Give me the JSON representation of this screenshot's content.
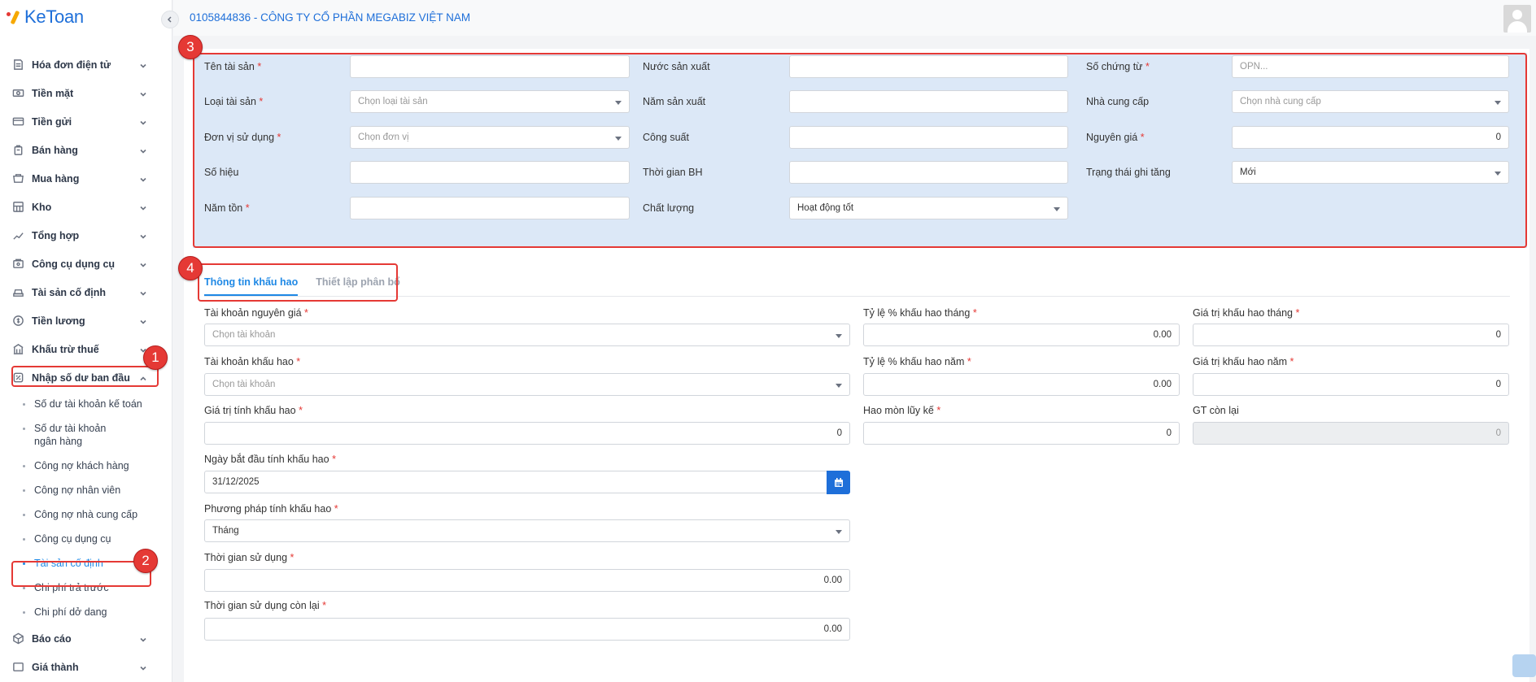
{
  "app": {
    "logo_text": "KeToan"
  },
  "header": {
    "company": "0105844836 - CÔNG TY CỔ PHẦN MEGABIZ VIỆT NAM"
  },
  "sidebar": {
    "items": [
      {
        "label": "Hóa đơn điện tử",
        "icon": "invoice-icon"
      },
      {
        "label": "Tiền mặt",
        "icon": "cash-icon"
      },
      {
        "label": "Tiền gửi",
        "icon": "bank-deposit-icon"
      },
      {
        "label": "Bán hàng",
        "icon": "sales-icon"
      },
      {
        "label": "Mua hàng",
        "icon": "purchase-icon"
      },
      {
        "label": "Kho",
        "icon": "warehouse-icon"
      },
      {
        "label": "Tổng hợp",
        "icon": "summary-icon"
      },
      {
        "label": "Công cụ dụng cụ",
        "icon": "tools-icon"
      },
      {
        "label": "Tài sản cố định",
        "icon": "fixed-asset-icon"
      },
      {
        "label": "Tiền lương",
        "icon": "salary-icon"
      },
      {
        "label": "Khấu trừ thuế",
        "icon": "tax-icon"
      },
      {
        "label": "Nhập số dư ban đầu",
        "icon": "opening-balance-icon"
      }
    ],
    "submenu": [
      "Số dư tài khoản kế toán",
      "Số dư tài khoản ngân hàng",
      "Công nợ khách hàng",
      "Công nợ nhân viên",
      "Công nợ nhà cung cấp",
      "Công cụ dụng cụ",
      "Tài sản cố định",
      "Chi phí trả trước",
      "Chi phí dở dang"
    ],
    "after": [
      {
        "label": "Báo cáo",
        "icon": "report-icon"
      },
      {
        "label": "Giá thành",
        "icon": "cost-icon"
      }
    ]
  },
  "form": {
    "ten_tai_san": {
      "label": "Tên tài sản",
      "value": ""
    },
    "nuoc_san_xuat": {
      "label": "Nước sản xuất",
      "value": ""
    },
    "so_chung_tu": {
      "label": "Số chứng từ",
      "placeholder": "OPN..."
    },
    "loai_tai_san": {
      "label": "Loại tài sản",
      "placeholder": "Chọn loại tài sản"
    },
    "nam_san_xuat": {
      "label": "Năm sản xuất",
      "value": ""
    },
    "nha_cung_cap": {
      "label": "Nhà cung cấp",
      "placeholder": "Chọn nhà cung cấp"
    },
    "don_vi_su_dung": {
      "label": "Đơn vị sử dụng",
      "placeholder": "Chọn đơn vị"
    },
    "cong_suat": {
      "label": "Công suất",
      "value": ""
    },
    "nguyen_gia": {
      "label": "Nguyên giá",
      "value": "0"
    },
    "so_hieu": {
      "label": "Số hiệu",
      "value": ""
    },
    "thoi_gian_bh": {
      "label": "Thời gian BH",
      "value": ""
    },
    "trang_thai_ghi_tang": {
      "label": "Trạng thái ghi tăng",
      "value": "Mới"
    },
    "nam_ton": {
      "label": "Năm tồn",
      "value": ""
    },
    "chat_luong": {
      "label": "Chất lượng",
      "value": "Hoạt động tốt"
    }
  },
  "tabs": [
    "Thông tin khấu hao",
    "Thiết lập phân bổ"
  ],
  "depreciation": {
    "tk_nguyen_gia": {
      "label": "Tài khoản nguyên giá",
      "placeholder": "Chọn tài khoản"
    },
    "ty_le_thang": {
      "label": "Tỷ lệ % khấu hao tháng",
      "value": "0.00"
    },
    "gia_tri_thang": {
      "label": "Giá trị khấu hao tháng",
      "value": "0"
    },
    "tk_khau_hao": {
      "label": "Tài khoản khấu hao",
      "placeholder": "Chọn tài khoản"
    },
    "ty_le_nam": {
      "label": "Tỷ lệ % khấu hao năm",
      "value": "0.00"
    },
    "gia_tri_nam": {
      "label": "Giá trị khấu hao năm",
      "value": "0"
    },
    "gia_tri_tinh": {
      "label": "Giá trị tính khấu hao",
      "value": "0"
    },
    "hao_mon": {
      "label": "Hao mòn lũy kế",
      "value": "0"
    },
    "gt_con_lai": {
      "label": "GT còn lại",
      "value": "0"
    },
    "ngay_bat_dau": {
      "label": "Ngày bắt đầu tính khấu hao",
      "value": "31/12/2025"
    },
    "phuong_phap": {
      "label": "Phương pháp tính khấu hao",
      "value": "Tháng"
    },
    "thoi_gian_su_dung": {
      "label": "Thời gian sử dụng",
      "value": "0.00"
    },
    "thoi_gian_con_lai": {
      "label": "Thời gian sử dụng còn lại",
      "value": "0.00"
    }
  },
  "annotations": [
    "1",
    "2",
    "3",
    "4"
  ],
  "colors": {
    "accent": "#1e6fd9",
    "highlight": "#e53935",
    "form_bg": "#dce8f7"
  }
}
